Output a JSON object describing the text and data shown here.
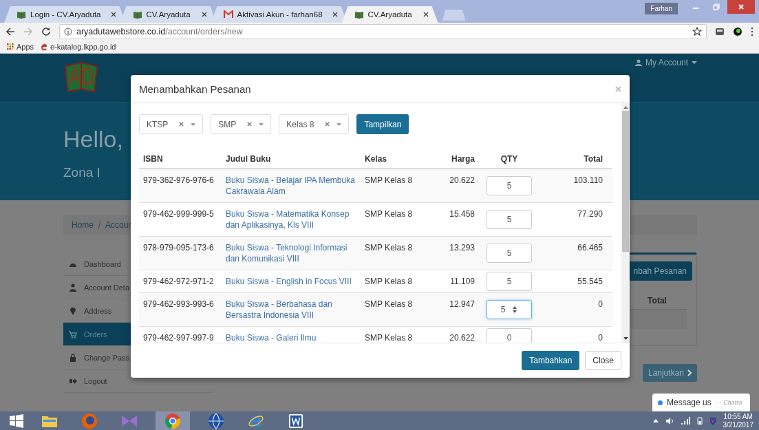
{
  "browser": {
    "tabs": [
      {
        "title": "Login - CV.Aryaduta",
        "kind": "site",
        "selected": false
      },
      {
        "title": "CV.Aryaduta",
        "kind": "site",
        "selected": false
      },
      {
        "title": "Aktivasi Akun - farhan68",
        "kind": "mail",
        "selected": false
      },
      {
        "title": "CV.Aryaduta",
        "kind": "site",
        "selected": true
      }
    ],
    "profile": "Farhan",
    "url_host": "aryadutawebstore.co.id",
    "url_path": "/account/orders/new",
    "bookmarks": [
      {
        "label": "Apps",
        "kind": "apps"
      },
      {
        "label": "e-katalog.lkpp.go.id",
        "kind": "ie"
      }
    ]
  },
  "page": {
    "account_menu": "My Account",
    "greeting": "Hello,",
    "zone": "Zona I",
    "breadcrumb": [
      "Home",
      "Accoun"
    ],
    "sidebar": [
      {
        "label": "Dashboard",
        "kind": "dashboard",
        "selected": false
      },
      {
        "label": "Account Deta",
        "kind": "user",
        "selected": false
      },
      {
        "label": "Address",
        "kind": "pin",
        "selected": false
      },
      {
        "label": "Orders",
        "kind": "cart",
        "selected": true
      },
      {
        "label": "Change Pass",
        "kind": "lock",
        "selected": false
      },
      {
        "label": "Logout",
        "kind": "logout",
        "selected": false
      }
    ],
    "card_button": "nbah Pesanan",
    "card_column": "Total",
    "next_button": "Lanjutkan"
  },
  "modal": {
    "title": "Menambahkan Pesanan",
    "filters": [
      "KTSP",
      "SMP",
      "Kelas 8"
    ],
    "show_button": "Tampilkan",
    "columns": [
      "ISBN",
      "Judul Buku",
      "Kelas",
      "Harga",
      "QTY",
      "Total"
    ],
    "rows": [
      {
        "isbn": "979-362-976-976-6",
        "title": "Buku Siswa - Belajar IPA Membuka Cakrawala Alam",
        "class": "SMP Kelas 8",
        "price": "20.622",
        "qty": "5",
        "focused": false,
        "total": "103.110"
      },
      {
        "isbn": "979-462-999-999-5",
        "title": "Buku Siswa - Matematika Konsep dan Aplikasinya, Kls VIII",
        "class": "SMP Kelas 8",
        "price": "15.458",
        "qty": "5",
        "focused": false,
        "total": "77.290"
      },
      {
        "isbn": "978-979-095-173-6",
        "title": "Buku Siswa - Teknologi Informasi dan Komunikasi VIII",
        "class": "SMP Kelas 8",
        "price": "13.293",
        "qty": "5",
        "focused": false,
        "total": "66.465"
      },
      {
        "isbn": "979-462-972-971-2",
        "title": "Buku Siswa - English in Focus VIII",
        "class": "SMP Kelas 8",
        "price": "11.109",
        "qty": "5",
        "focused": false,
        "total": "55.545"
      },
      {
        "isbn": "979-462-993-993-6",
        "title": "Buku Siswa - Berbahasa dan Bersastra Indonesia VIII",
        "class": "SMP Kelas 8",
        "price": "12.947",
        "qty": "5",
        "focused": true,
        "total": "0"
      },
      {
        "isbn": "979-462-997-997-9",
        "title": "Buku Siswa - Galeri Ilmu",
        "class": "SMP Kelas 8",
        "price": "20.622",
        "qty": "0",
        "focused": false,
        "total": "0"
      }
    ],
    "add_button": "Tambahkan",
    "close_button": "Close"
  },
  "chat": {
    "label": "Message us",
    "brand": "··· Chatra"
  },
  "taskbar": {
    "apps": [
      {
        "kind": "explorer",
        "selected": false
      },
      {
        "kind": "firefox",
        "selected": false
      },
      {
        "kind": "bow",
        "selected": false
      },
      {
        "kind": "chrome",
        "selected": true
      },
      {
        "kind": "globe",
        "selected": false
      },
      {
        "kind": "ie",
        "selected": false
      },
      {
        "kind": "word",
        "selected": false
      }
    ],
    "time": "10:55 AM",
    "date": "3/21/2017"
  }
}
